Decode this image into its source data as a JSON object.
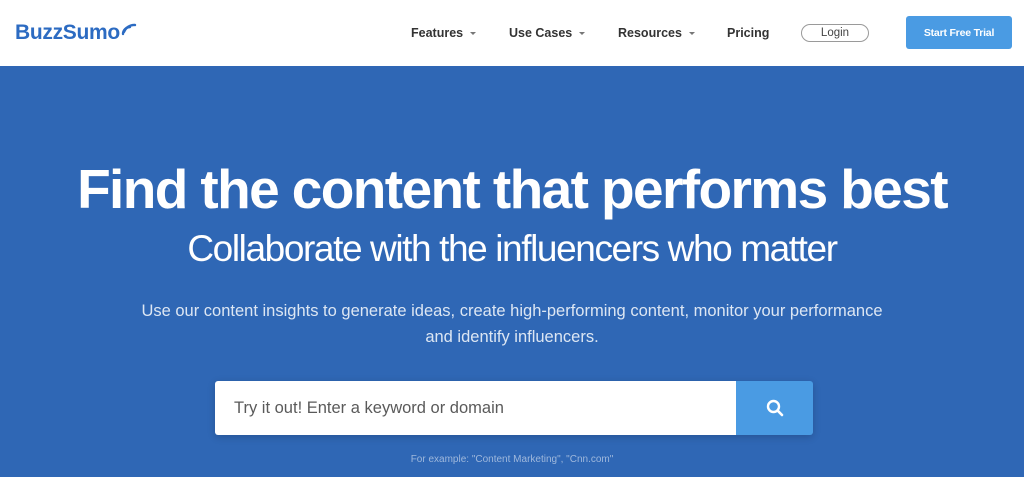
{
  "brand": {
    "name": "BuzzSumo",
    "color": "#2c6bc2"
  },
  "nav": {
    "items": [
      {
        "label": "Features",
        "has_dropdown": true
      },
      {
        "label": "Use Cases",
        "has_dropdown": true
      },
      {
        "label": "Resources",
        "has_dropdown": true
      },
      {
        "label": "Pricing",
        "has_dropdown": false
      }
    ],
    "login_label": "Login",
    "trial_label": "Start Free Trial"
  },
  "hero": {
    "title": "Find the content that performs best",
    "subtitle": "Collaborate with the influencers who matter",
    "description_line1": "Use our content insights to generate ideas, create high-performing content, monitor your performance",
    "description_line2": "and identify influencers.",
    "background_color": "#2f67b5"
  },
  "search": {
    "placeholder": "Try it out! Enter a keyword or domain",
    "value": "",
    "button_icon": "search-icon",
    "example": "For example: \"Content Marketing\", \"Cnn.com\""
  },
  "colors": {
    "accent": "#4a9be3",
    "hero_bg": "#2f67b5",
    "brand": "#2c6bc2"
  }
}
